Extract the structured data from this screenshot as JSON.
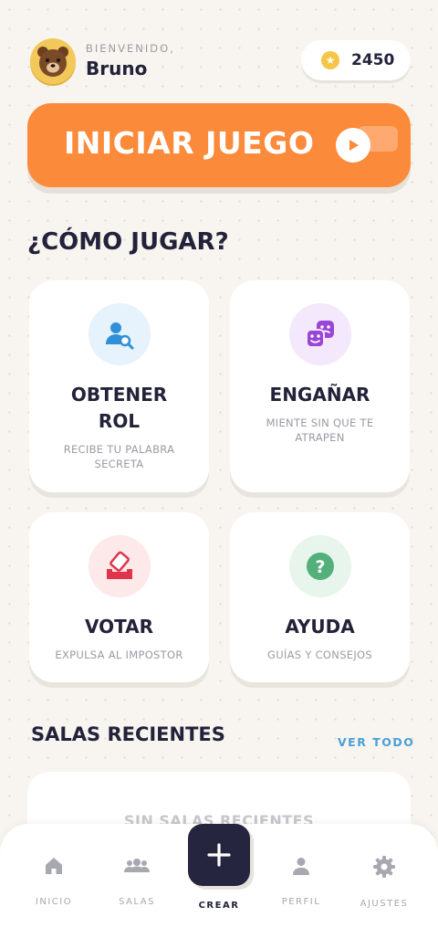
{
  "header": {
    "greeting": "BIENVENIDO,",
    "username": "Bruno",
    "coins": "2450"
  },
  "start_button": {
    "label": "INICIAR JUEGO"
  },
  "how_to_play": {
    "title": "¿CÓMO JUGAR?",
    "cards": [
      {
        "title": "OBTENER ROL",
        "desc": "RECIBE TU PALABRA SECRETA",
        "icon": "user-search-icon",
        "color": "#2f8fd8",
        "bg": "#e6f2fc"
      },
      {
        "title": "ENGAÑAR",
        "desc": "MIENTE SIN QUE TE ATRAPEN",
        "icon": "masks-icon",
        "color": "#9a45d6",
        "bg": "#f3e8fc"
      },
      {
        "title": "VOTAR",
        "desc": "EXPULSA AL IMPOSTOR",
        "icon": "ballot-box-icon",
        "color": "#e0344a",
        "bg": "#fde8ea"
      },
      {
        "title": "AYUDA",
        "desc": "GUÍAS Y CONSEJOS",
        "icon": "question-icon",
        "color": "#54b07a",
        "bg": "#e7f5ec"
      }
    ]
  },
  "recent": {
    "title": "SALAS RECIENTES",
    "see_all": "VER TODO",
    "empty": "SIN SALAS RECIENTES"
  },
  "nav": {
    "items": [
      {
        "label": "INICIO",
        "icon": "home-icon"
      },
      {
        "label": "SALAS",
        "icon": "group-icon"
      },
      {
        "label": "CREAR",
        "icon": "plus-icon"
      },
      {
        "label": "PERFIL",
        "icon": "person-icon"
      },
      {
        "label": "AJUSTES",
        "icon": "gear-icon"
      }
    ]
  },
  "colors": {
    "accent": "#fb8a3b",
    "dark": "#25253f",
    "link": "#4aa0d8",
    "coin": "#f5c545"
  }
}
